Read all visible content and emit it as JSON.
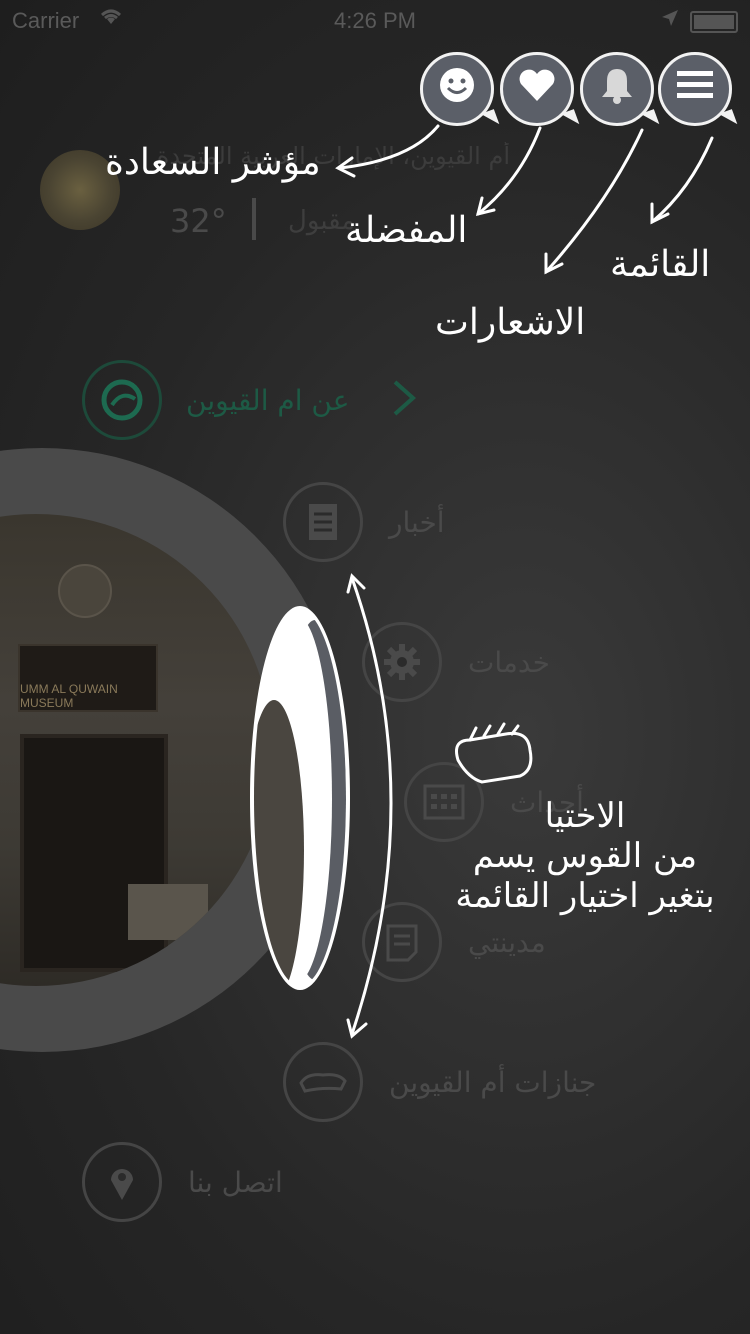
{
  "status_bar": {
    "carrier": "Carrier",
    "time": "4:26 PM"
  },
  "weather": {
    "city": "أم القيوين، الإمارات العربية المتحدة",
    "temperature": "32°",
    "condition": "مقبول"
  },
  "menu": {
    "items": [
      {
        "label": "عن ام القيوين",
        "icon": "app-logo-icon"
      },
      {
        "label": "أخبار",
        "icon": "document-icon"
      },
      {
        "label": "خدمات",
        "icon": "gear-icon"
      },
      {
        "label": "أحداث",
        "icon": "calendar-icon"
      },
      {
        "label": "مدينتي",
        "icon": "note-icon"
      },
      {
        "label": "جنازات أم القيوين",
        "icon": "coffin-icon"
      },
      {
        "label": "اتصل بنا",
        "icon": "location-pin-icon"
      }
    ]
  },
  "photo": {
    "sign_text": "UMM AL QUWAIN MUSEUM"
  },
  "annotations": {
    "happiness": "مؤشر السعادة",
    "favorites": "المفضلة",
    "menu": "القائمة",
    "notifications": "الاشعارات",
    "swipe_line1": "الاختيا",
    "swipe_line2": "من القوس يسم",
    "swipe_line3": "بتغير اختيار القائمة"
  },
  "colors": {
    "accent": "#1d6a50",
    "overlay": "#2b2b2b",
    "button": "#5b5f68"
  }
}
